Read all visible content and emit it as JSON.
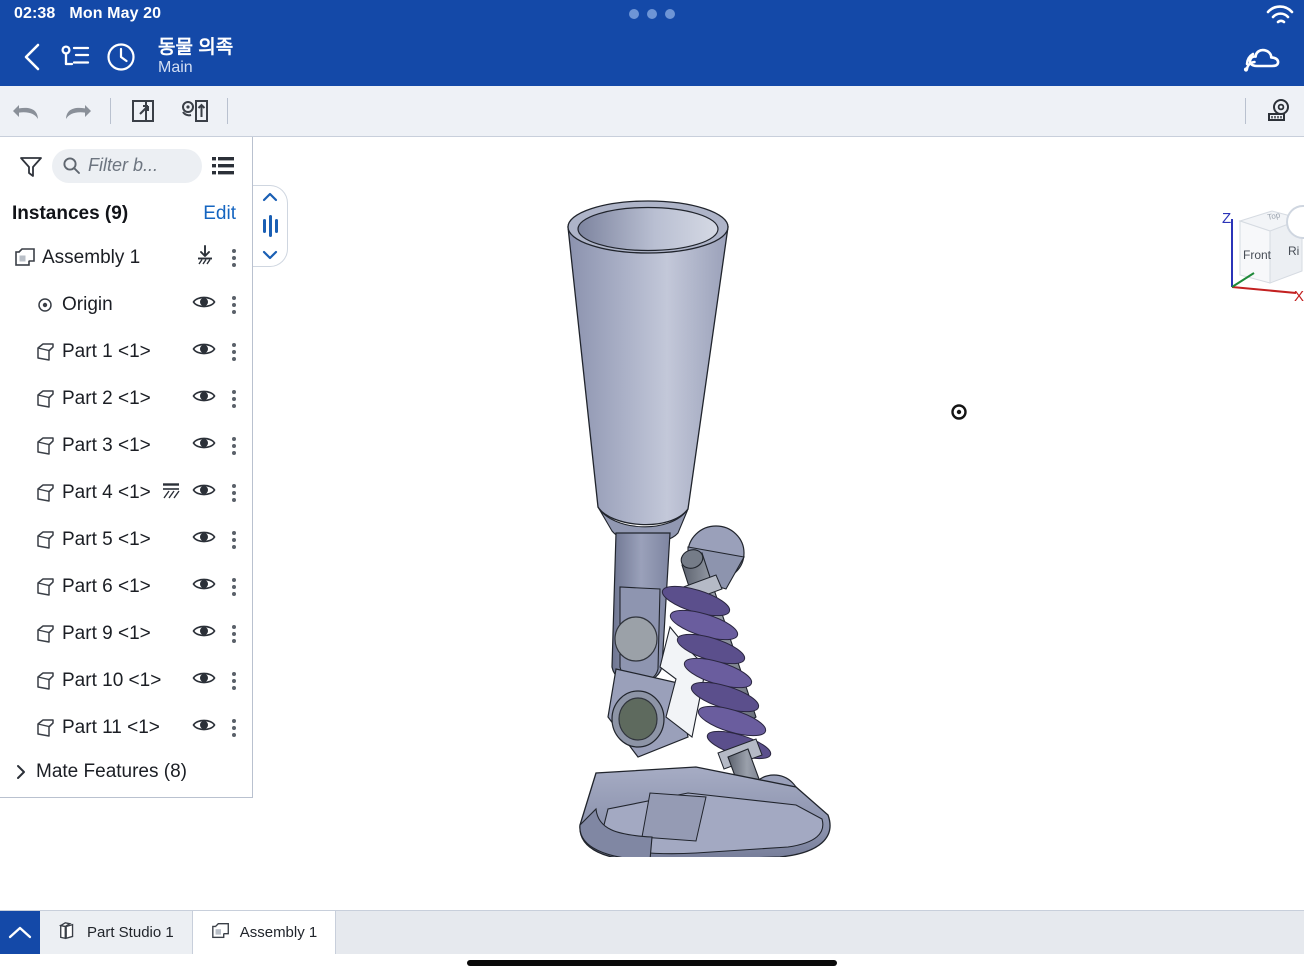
{
  "status_bar": {
    "time": "02:38",
    "date": "Mon May 20",
    "wifi_icon": "wifi-icon",
    "dots_icon": "camera-cutout-dots"
  },
  "app_bar": {
    "back_icon": "chevron-left-icon",
    "feature_list_icon": "feature-list-icon",
    "history_icon": "clock-history-icon",
    "document_title": "동물 의족",
    "workspace": "Main",
    "cloud_icon": "cloud-sync-icon"
  },
  "toolbar": {
    "undo_icon": "undo-icon",
    "redo_icon": "redo-icon",
    "insert_icon": "insert-part-icon",
    "transform_icon": "transform-icon",
    "measure_icon": "measure-tape-icon"
  },
  "tree_panel": {
    "filter_icon": "filter-funnel-icon",
    "search_icon": "search-icon",
    "filter_placeholder": "Filter b...",
    "list_icon": "list-view-icon",
    "instances_label": "Instances (9)",
    "edit_label": "Edit",
    "root": {
      "label": "Assembly 1",
      "icon": "assembly-icon",
      "fix_icon": "ground-fix-icon",
      "kebab_icon": "kebab-menu-icon"
    },
    "items": [
      {
        "label": "Origin",
        "icon": "origin-icon",
        "eye_icon": "eye-visible-icon",
        "kebab_icon": "kebab-menu-icon",
        "fixed": false
      },
      {
        "label": "Part 1 <1>",
        "icon": "part-icon",
        "eye_icon": "eye-visible-icon",
        "kebab_icon": "kebab-menu-icon",
        "fixed": false
      },
      {
        "label": "Part 2 <1>",
        "icon": "part-icon",
        "eye_icon": "eye-visible-icon",
        "kebab_icon": "kebab-menu-icon",
        "fixed": false
      },
      {
        "label": "Part 3 <1>",
        "icon": "part-icon",
        "eye_icon": "eye-visible-icon",
        "kebab_icon": "kebab-menu-icon",
        "fixed": false
      },
      {
        "label": "Part 4 <1>",
        "icon": "part-icon",
        "eye_icon": "eye-visible-icon",
        "kebab_icon": "kebab-menu-icon",
        "fixed": true
      },
      {
        "label": "Part 5 <1>",
        "icon": "part-icon",
        "eye_icon": "eye-visible-icon",
        "kebab_icon": "kebab-menu-icon",
        "fixed": false
      },
      {
        "label": "Part 6 <1>",
        "icon": "part-icon",
        "eye_icon": "eye-visible-icon",
        "kebab_icon": "kebab-menu-icon",
        "fixed": false
      },
      {
        "label": "Part 9 <1>",
        "icon": "part-icon",
        "eye_icon": "eye-visible-icon",
        "kebab_icon": "kebab-menu-icon",
        "fixed": false
      },
      {
        "label": "Part 10 <1>",
        "icon": "part-icon",
        "eye_icon": "eye-visible-icon",
        "kebab_icon": "kebab-menu-icon",
        "fixed": false
      },
      {
        "label": "Part 11 <1>",
        "icon": "part-icon",
        "eye_icon": "eye-visible-icon",
        "kebab_icon": "kebab-menu-icon",
        "fixed": false
      }
    ],
    "mate_features": {
      "label": "Mate Features (8)",
      "expand_icon": "chevron-right-icon"
    }
  },
  "viewport": {
    "origin_marker": "origin-point-marker",
    "view_cube": {
      "front_label": "Front",
      "right_label": "Ri",
      "top_label": "Top",
      "axis_x": "X",
      "axis_z": "Z"
    },
    "model_name": "animal-prosthetic-leg-assembly"
  },
  "tab_bar": {
    "home_icon": "chevron-up-icon",
    "tabs": [
      {
        "label": "Part Studio 1",
        "icon": "part-studio-icon",
        "active": false
      },
      {
        "label": "Assembly 1",
        "icon": "assembly-icon",
        "active": true
      }
    ]
  },
  "colors": {
    "header_blue": "#1449a8",
    "accent_blue": "#1565c0",
    "toolbar_bg": "#eef1f6",
    "spring_purple": "#5b4f8c",
    "body_steel": "#98a0bd"
  }
}
